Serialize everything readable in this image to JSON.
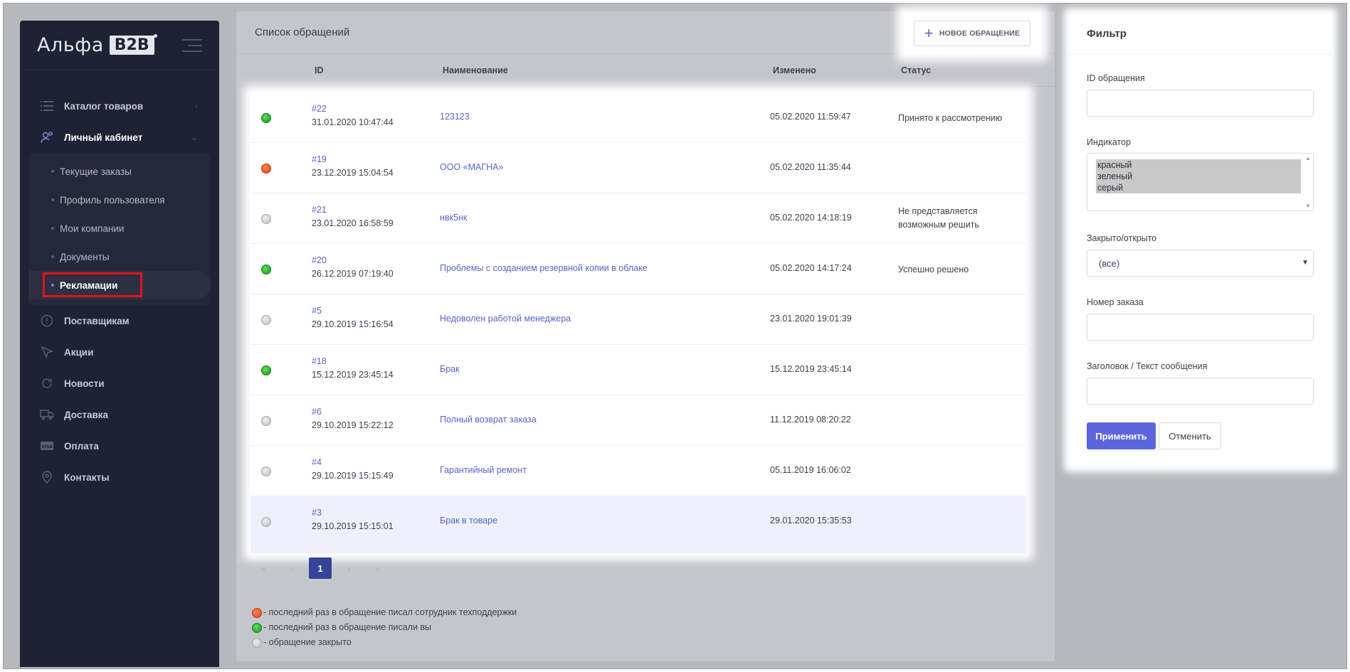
{
  "sidebar": {
    "logo_text": "Альфа",
    "logo_badge": "B2B",
    "items": [
      {
        "label": "Каталог товаров",
        "icon": "list-icon"
      },
      {
        "label": "Личный кабинет",
        "icon": "user-settings-icon"
      },
      {
        "label": "Поставщикам",
        "icon": "info-circle-icon"
      },
      {
        "label": "Акции",
        "icon": "tag-icon"
      },
      {
        "label": "Новости",
        "icon": "refresh-icon"
      },
      {
        "label": "Доставка",
        "icon": "truck-icon"
      },
      {
        "label": "Оплата",
        "icon": "card-icon"
      },
      {
        "label": "Контакты",
        "icon": "map-pin-icon"
      }
    ],
    "subitems": [
      {
        "label": "Текущие заказы"
      },
      {
        "label": "Профиль пользователя"
      },
      {
        "label": "Мои компании"
      },
      {
        "label": "Документы"
      },
      {
        "label": "Рекламации"
      }
    ]
  },
  "main": {
    "title": "Список обращений",
    "new_button": "НОВОЕ ОБРАЩЕНИЕ",
    "columns": {
      "id": "ID",
      "name": "Наименование",
      "changed": "Изменено",
      "status": "Статус"
    },
    "rows": [
      {
        "indicator": "green",
        "id": "#22",
        "created": "31.01.2020 10:47:44",
        "name": "123123",
        "changed": "05.02.2020 11:59:47",
        "status": "Принято к рассмотрению"
      },
      {
        "indicator": "red",
        "id": "#19",
        "created": "23.12.2019 15:04:54",
        "name": "ООО «МАГНА»",
        "changed": "05.02.2020 11:35:44",
        "status": ""
      },
      {
        "indicator": "gray",
        "id": "#21",
        "created": "23.01.2020 16:58:59",
        "name": "нвк5нк",
        "changed": "05.02.2020 14:18:19",
        "status": "Не представляется возможным решить"
      },
      {
        "indicator": "green",
        "id": "#20",
        "created": "26.12.2019 07:19:40",
        "name": "Проблемы с созданием резервной копии в облаке",
        "changed": "05.02.2020 14:17:24",
        "status": "Успешно решено"
      },
      {
        "indicator": "gray",
        "id": "#5",
        "created": "29.10.2019 15:16:54",
        "name": "Недоволен работой менеджера",
        "changed": "23.01.2020 19:01:39",
        "status": ""
      },
      {
        "indicator": "green",
        "id": "#18",
        "created": "15.12.2019 23:45:14",
        "name": "Брак",
        "changed": "15.12.2019 23:45:14",
        "status": ""
      },
      {
        "indicator": "gray",
        "id": "#6",
        "created": "29.10.2019 15:22:12",
        "name": "Полный возврат заказа",
        "changed": "11.12.2019 08:20:22",
        "status": ""
      },
      {
        "indicator": "gray",
        "id": "#4",
        "created": "29.10.2019 15:15:49",
        "name": "Гарантийный ремонт",
        "changed": "05.11.2019 16:06:02",
        "status": ""
      },
      {
        "indicator": "gray",
        "id": "#3",
        "created": "29.10.2019 15:15:01",
        "name": "Брак в товаре",
        "changed": "29.01.2020 15:35:53",
        "status": ""
      }
    ],
    "pager": {
      "first": "«",
      "prev": "‹",
      "current": "1",
      "next": "›",
      "last": "»"
    },
    "legend": [
      {
        "color": "red",
        "text": "- последний раз в обращение писал сотрудник техподдержки"
      },
      {
        "color": "green",
        "text": "- последний раз в обращение писали вы"
      },
      {
        "color": "gray",
        "text": "- обращение закрыто"
      }
    ]
  },
  "filter": {
    "title": "Фильтр",
    "id_label": "ID обращения",
    "indicator_label": "Индикатор",
    "indicator_options": [
      "красный",
      "зеленый",
      "серый"
    ],
    "closed_label": "Закрыто/открыто",
    "closed_value": "(все)",
    "order_label": "Номер заказа",
    "text_label": "Заголовок / Текст сообщения",
    "apply": "Применить",
    "cancel": "Отменить"
  },
  "colors": {
    "accent": "#5c65dc",
    "sidebar_bg": "#1f2232",
    "highlight": "#e0151b"
  }
}
